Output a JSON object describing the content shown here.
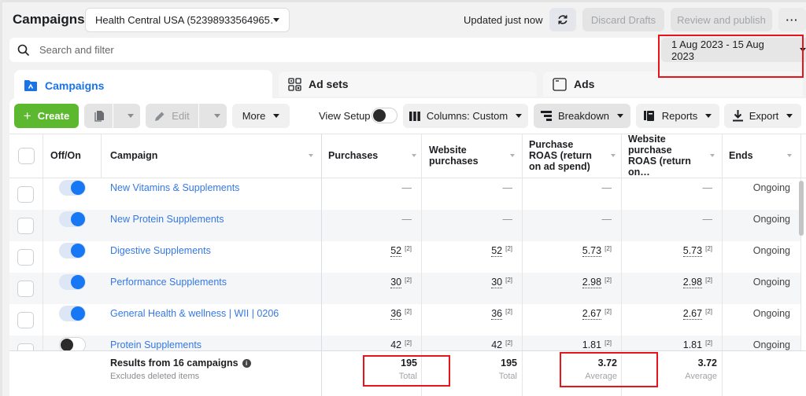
{
  "header": {
    "title": "Campaigns",
    "account_selector": "Health Central USA (52398933564965…",
    "updated_status": "Updated just now",
    "discard_label": "Discard Drafts",
    "publish_label": "Review and publish",
    "more_label": "···"
  },
  "search": {
    "placeholder": "Search and filter",
    "date_range": "1 Aug 2023 - 15 Aug 2023"
  },
  "tabs": [
    {
      "label": "Campaigns",
      "icon": "folder-icon",
      "active": true
    },
    {
      "label": "Ad sets",
      "icon": "grid-icon",
      "active": false
    },
    {
      "label": "Ads",
      "icon": "window-icon",
      "active": false
    }
  ],
  "toolbar": {
    "create_label": "Create",
    "edit_label": "Edit",
    "more_label": "More",
    "view_setup_label": "View Setup",
    "columns_label": "Columns: Custom",
    "breakdown_label": "Breakdown",
    "reports_label": "Reports",
    "export_label": "Export"
  },
  "table": {
    "columns": [
      {
        "key": "toggle",
        "label": "Off/On"
      },
      {
        "key": "campaign",
        "label": "Campaign"
      },
      {
        "key": "purchases",
        "label": "Purchases"
      },
      {
        "key": "website_purchases",
        "label": "Website purchases"
      },
      {
        "key": "purchase_roas",
        "label": "Purchase ROAS (return on ad spend)"
      },
      {
        "key": "website_purchase_roas",
        "label": "Website purchase ROAS (return on…"
      },
      {
        "key": "ends",
        "label": "Ends"
      }
    ],
    "rows": [
      {
        "name": "New Vitamins & Supplements",
        "on": true,
        "purchases": "—",
        "website_purchases": "—",
        "purchase_roas": "—",
        "website_purchase_roas": "—",
        "ends": "Ongoing"
      },
      {
        "name": "New Protein Supplements",
        "on": true,
        "purchases": "—",
        "website_purchases": "—",
        "purchase_roas": "—",
        "website_purchase_roas": "—",
        "ends": "Ongoing"
      },
      {
        "name": "Digestive Supplements",
        "on": true,
        "purchases": "52",
        "website_purchases": "52",
        "purchase_roas": "5.73",
        "website_purchase_roas": "5.73",
        "ends": "Ongoing"
      },
      {
        "name": "Performance Supplements",
        "on": true,
        "purchases": "30",
        "website_purchases": "30",
        "purchase_roas": "2.98",
        "website_purchase_roas": "2.98",
        "ends": "Ongoing"
      },
      {
        "name": "General Health & wellness | WII | 0206",
        "on": true,
        "purchases": "36",
        "website_purchases": "36",
        "purchase_roas": "2.67",
        "website_purchase_roas": "2.67",
        "ends": "Ongoing"
      },
      {
        "name": "Protein Supplements",
        "on": false,
        "purchases": "42",
        "website_purchases": "42",
        "purchase_roas": "1.81",
        "website_purchase_roas": "1.81",
        "ends": "Ongoing"
      }
    ],
    "footnote_marker": "[2]"
  },
  "summary": {
    "title": "Results from 16 campaigns",
    "subtitle": "Excludes deleted items",
    "purchases": {
      "value": "195",
      "label": "Total"
    },
    "website_purchases": {
      "value": "195",
      "label": "Total"
    },
    "purchase_roas": {
      "value": "3.72",
      "label": "Average"
    },
    "website_purchase_roas": {
      "value": "3.72",
      "label": "Average"
    }
  },
  "annotations": {
    "highlight_color": "#e8141a"
  }
}
